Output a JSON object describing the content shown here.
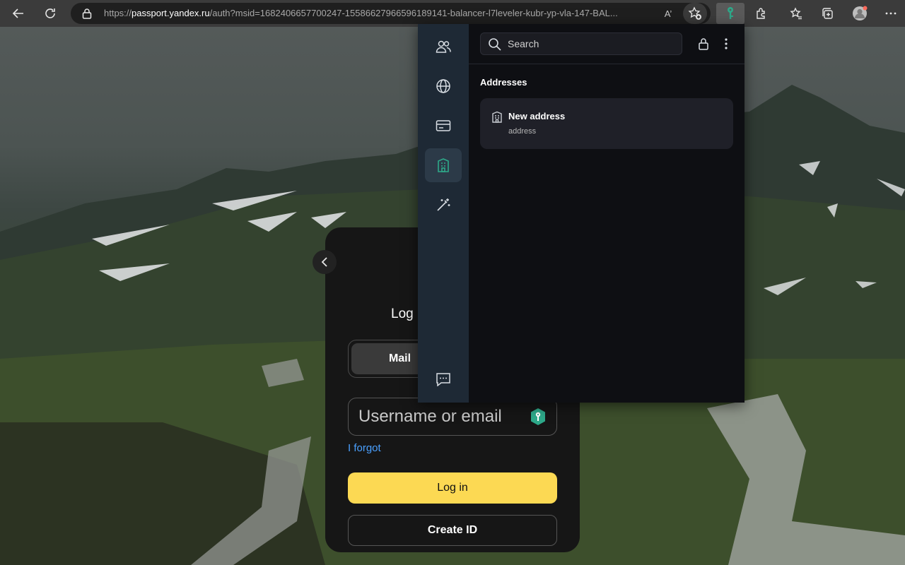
{
  "browser": {
    "url_prefix": "https://",
    "url_domain": "passport.yandex.ru",
    "url_rest": "/auth?msid=1682406657700247-15586627966596189141-balancer-l7leveler-kubr-yp-vla-147-BAL...",
    "read_aloud_label": "A’",
    "accent_color": "#2ea98a"
  },
  "login": {
    "title": "Log i",
    "mail_tab": "Mail",
    "username_placeholder": "Username or email",
    "forgot_link": "I forgot",
    "login_button": "Log in",
    "create_button": "Create ID",
    "brand_color": "#fcd953"
  },
  "popup": {
    "search_placeholder": "Search",
    "rail_items": [
      "people-icon",
      "globe-icon",
      "card-icon",
      "building-icon",
      "magic-wand-icon",
      "chat-icon"
    ],
    "active_item": "building-icon",
    "section_title": "Addresses",
    "items": [
      {
        "title": "New address",
        "subtitle": "address"
      }
    ]
  }
}
